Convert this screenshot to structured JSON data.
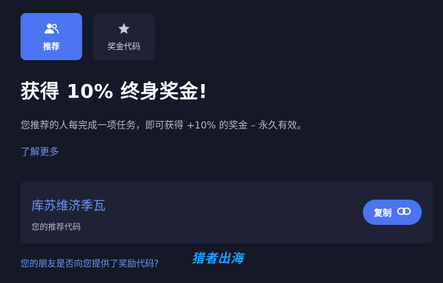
{
  "tabs": [
    {
      "label": "推荐",
      "icon": "users-icon",
      "active": true
    },
    {
      "label": "奖金代码",
      "icon": "star-icon",
      "active": false
    }
  ],
  "headline": "获得 10% 终身奖金!",
  "description": "您推荐的人每完成一项任务，即可获得 +10% 的奖金 – 永久有效。",
  "learn_more": "了解更多",
  "referral": {
    "code": "库苏维济季瓦",
    "label": "您的推荐代码",
    "copy_label": "复制"
  },
  "footer_question": "您的朋友是否向您提供了奖励代码?",
  "watermark": "猎者出海",
  "colors": {
    "background": "#151827",
    "accent": "#4a74f0",
    "link": "#6f95f5",
    "card": "#1f2236"
  }
}
